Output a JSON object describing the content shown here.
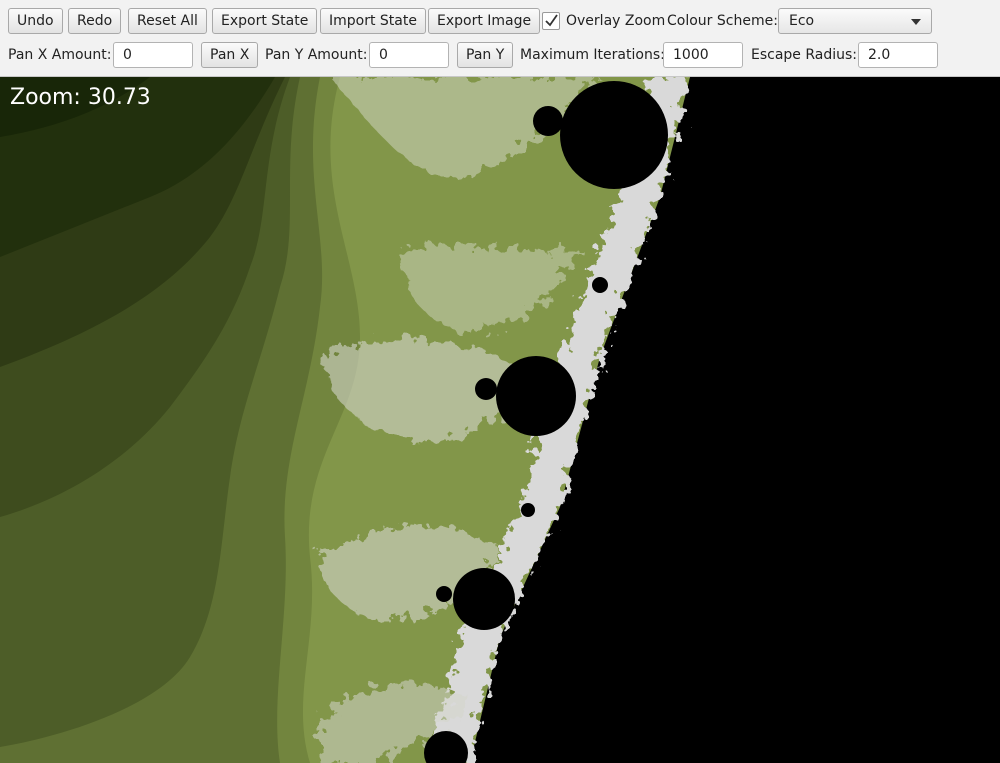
{
  "toolbar": {
    "undo": "Undo",
    "redo": "Redo",
    "reset_all": "Reset All",
    "export_state": "Export State",
    "import_state": "Import State",
    "export_image": "Export Image",
    "overlay_zoom_label": "Overlay Zoom",
    "overlay_zoom_checked": true,
    "colour_scheme_label": "Colour Scheme:",
    "colour_scheme_value": "Eco",
    "pan_x_label": "Pan X Amount:",
    "pan_x_value": "0",
    "pan_x_button": "Pan X",
    "pan_y_label": "Pan Y Amount:",
    "pan_y_value": "0",
    "pan_y_button": "Pan Y",
    "max_iter_label": "Maximum Iterations:",
    "max_iter_value": "1000",
    "escape_radius_label": "Escape Radius:",
    "escape_radius_value": "2.0"
  },
  "canvas": {
    "zoom_overlay": "Zoom: 30.73"
  },
  "colors": {
    "band_darkest": "#1a2c09",
    "band_light": "#7d8e47",
    "fractal_edge": "#d8d8d8",
    "set_interior": "#000000"
  },
  "icons": {
    "checkbox": "check-icon",
    "dropdown": "caret-down-icon"
  }
}
